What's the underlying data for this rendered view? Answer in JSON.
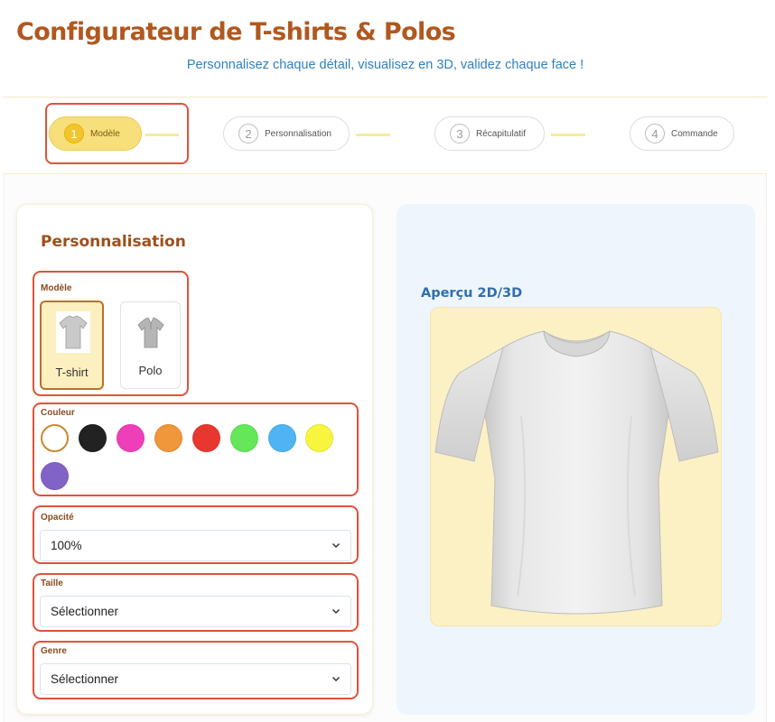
{
  "header": {
    "title": "Configurateur de T-shirts & Polos",
    "subtitle": "Personnalisez chaque détail, visualisez en 3D, validez chaque face !"
  },
  "steps": [
    {
      "number": "1",
      "label": "Modèle",
      "active": true
    },
    {
      "number": "2",
      "label": "Personnalisation",
      "active": false
    },
    {
      "number": "3",
      "label": "Récapitulatif",
      "active": false
    },
    {
      "number": "4",
      "label": "Commande",
      "active": false
    }
  ],
  "panel": {
    "title": "Personnalisation",
    "model": {
      "label": "Modèle",
      "options": [
        {
          "label": "T-shirt",
          "icon": "tshirt-icon",
          "selected": true
        },
        {
          "label": "Polo",
          "icon": "polo-icon",
          "selected": false
        }
      ]
    },
    "color": {
      "label": "Couleur",
      "swatches": [
        "#ffffff",
        "#222222",
        "#ee3fb9",
        "#f0963b",
        "#e8372e",
        "#64e85a",
        "#4fb4f3",
        "#f8f53f",
        "#8162c6"
      ],
      "selected": "#ffffff"
    },
    "opacity": {
      "label": "Opacité",
      "value": "100%"
    },
    "size": {
      "label": "Taille",
      "value": "Sélectionner"
    },
    "gender": {
      "label": "Genre",
      "value": "Sélectionner"
    }
  },
  "preview": {
    "title": "Aperçu 2D/3D",
    "garment": "tshirt-preview-image"
  },
  "colors": {
    "accent": "#b0581f",
    "subtitle": "#2f80c2",
    "highlight": "#e0523a",
    "step_active": "#f7df7b"
  }
}
